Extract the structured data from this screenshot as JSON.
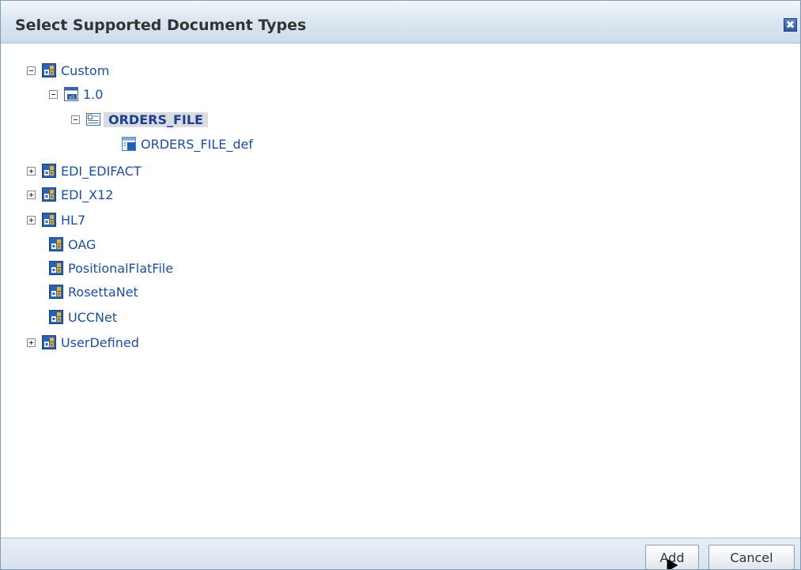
{
  "dialog": {
    "title": "Select Supported Document Types",
    "close_label": "✖"
  },
  "tree": {
    "nodes": [
      {
        "label": "Custom",
        "icon": "document-protocol-icon",
        "expander": "collapse"
      },
      {
        "label": "1.0",
        "icon": "version-icon",
        "expander": "collapse"
      },
      {
        "label": "ORDERS_FILE",
        "icon": "document-type-icon",
        "expander": "collapse",
        "selected": true
      },
      {
        "label": "ORDERS_FILE_def",
        "icon": "document-definition-icon",
        "expander": "none"
      },
      {
        "label": "EDI_EDIFACT",
        "icon": "document-protocol-icon",
        "expander": "expand"
      },
      {
        "label": "EDI_X12",
        "icon": "document-protocol-icon",
        "expander": "expand"
      },
      {
        "label": "HL7",
        "icon": "document-protocol-icon",
        "expander": "expand"
      },
      {
        "label": "OAG",
        "icon": "document-protocol-icon",
        "expander": "none"
      },
      {
        "label": "PositionalFlatFile",
        "icon": "document-protocol-icon",
        "expander": "none"
      },
      {
        "label": "RosettaNet",
        "icon": "document-protocol-icon",
        "expander": "none"
      },
      {
        "label": "UCCNet",
        "icon": "document-protocol-icon",
        "expander": "none"
      },
      {
        "label": "UserDefined",
        "icon": "document-protocol-icon",
        "expander": "expand"
      }
    ]
  },
  "footer": {
    "add_label": "Add",
    "cancel_label": "Cancel"
  },
  "colors": {
    "link": "#1c4fa3",
    "title_text": "#333333",
    "selection_bg": "#d9dde3"
  }
}
